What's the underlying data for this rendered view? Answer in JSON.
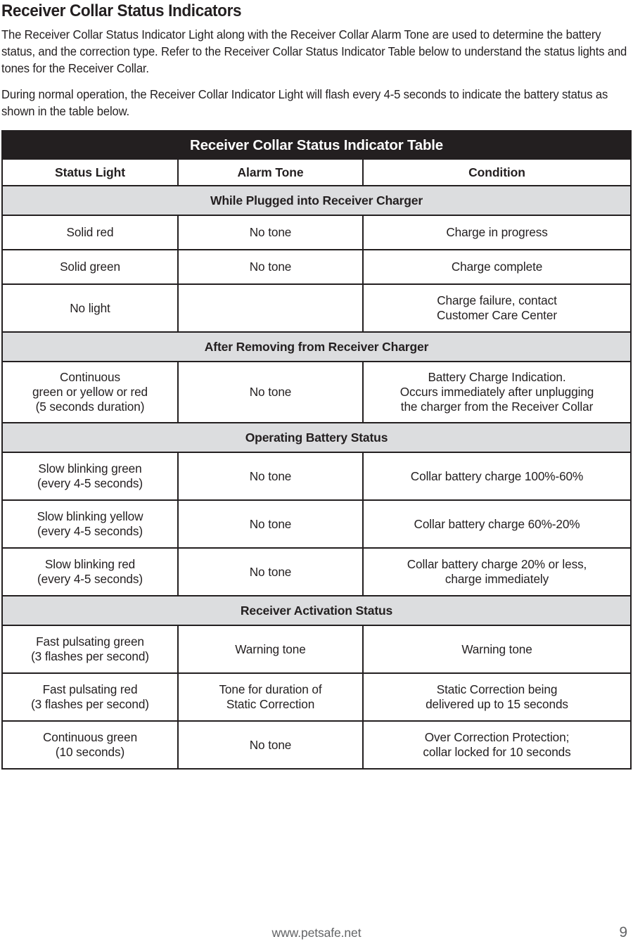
{
  "document": {
    "title": "Receiver Collar Status Indicators",
    "paragraphs": [
      "The Receiver Collar Status Indicator Light along with the Receiver Collar Alarm Tone are used to determine the battery status, and the correction type. Refer to the Receiver Collar Status Indicator Table below to understand the status lights and tones for the Receiver Collar.",
      "During normal operation, the Receiver Collar Indicator Light will flash every 4-5 seconds to indicate the battery status as shown in the table below."
    ]
  },
  "table": {
    "title": "Receiver Collar Status Indicator Table",
    "columns": [
      "Status Light",
      "Alarm Tone",
      "Condition"
    ],
    "sections": [
      {
        "heading": "While Plugged into Receiver Charger",
        "rows": [
          {
            "status_light": [
              "Solid red"
            ],
            "alarm_tone": [
              "No tone"
            ],
            "condition": [
              "Charge in progress"
            ]
          },
          {
            "status_light": [
              "Solid green"
            ],
            "alarm_tone": [
              "No tone"
            ],
            "condition": [
              "Charge complete"
            ]
          },
          {
            "status_light": [
              "No light"
            ],
            "alarm_tone": [],
            "condition": [
              "Charge failure, contact",
              "Customer Care Center"
            ]
          }
        ]
      },
      {
        "heading": "After Removing from Receiver Charger",
        "rows": [
          {
            "status_light": [
              "Continuous",
              "green or yellow or red",
              "(5 seconds duration)"
            ],
            "alarm_tone": [
              "No tone"
            ],
            "condition": [
              "Battery Charge Indication.",
              "Occurs immediately after unplugging",
              "the charger from the Receiver Collar"
            ]
          }
        ]
      },
      {
        "heading": "Operating Battery Status",
        "rows": [
          {
            "status_light": [
              "Slow blinking green",
              "(every 4-5 seconds)"
            ],
            "alarm_tone": [
              "No tone"
            ],
            "condition": [
              "Collar battery charge 100%-60%"
            ]
          },
          {
            "status_light": [
              "Slow blinking yellow",
              "(every 4-5 seconds)"
            ],
            "alarm_tone": [
              "No tone"
            ],
            "condition": [
              "Collar battery charge 60%-20%"
            ]
          },
          {
            "status_light": [
              "Slow blinking red",
              "(every 4-5 seconds)"
            ],
            "alarm_tone": [
              "No tone"
            ],
            "condition": [
              "Collar battery charge 20% or less,",
              "charge immediately"
            ]
          }
        ]
      },
      {
        "heading": "Receiver Activation Status",
        "rows": [
          {
            "status_light": [
              "Fast pulsating green",
              "(3 flashes per second)"
            ],
            "alarm_tone": [
              "Warning tone"
            ],
            "condition": [
              "Warning tone"
            ]
          },
          {
            "status_light": [
              "Fast pulsating red",
              "(3 flashes per second)"
            ],
            "alarm_tone": [
              "Tone for duration of",
              "Static Correction"
            ],
            "condition": [
              "Static Correction being",
              "delivered up to 15 seconds"
            ]
          },
          {
            "status_light": [
              "Continuous green",
              "(10 seconds)"
            ],
            "alarm_tone": [
              "No tone"
            ],
            "condition": [
              "Over Correction Protection;",
              "collar locked for 10 seconds"
            ]
          }
        ]
      }
    ]
  },
  "footer": {
    "url": "www.petsafe.net",
    "page_number": "9"
  },
  "colors": {
    "header_bar": "#231f20",
    "section_row": "#dcdddf",
    "text": "#231f20",
    "footer_text": "#636466"
  }
}
